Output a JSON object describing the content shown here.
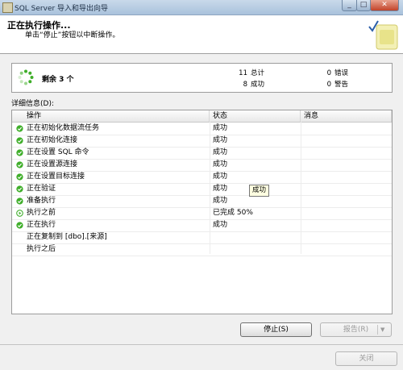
{
  "window": {
    "title": "SQL Server 导入和导出向导"
  },
  "header": {
    "title": "正在执行操作...",
    "subtitle": "单击“停止”按钮以中断操作。"
  },
  "summary": {
    "remaining": "剩余 3 个",
    "total_count": "11",
    "total_label": "总计",
    "success_count": "8",
    "success_label": "成功",
    "error_count": "0",
    "error_label": "错误",
    "warning_count": "0",
    "warning_label": "警告"
  },
  "details": {
    "label": "详细信息(D):",
    "columns": {
      "action": "操作",
      "status": "状态",
      "message": "消息"
    },
    "rows": [
      {
        "icon": "success-icon",
        "action": "正在初始化数据流任务",
        "status": "成功"
      },
      {
        "icon": "success-icon",
        "action": "正在初始化连接",
        "status": "成功"
      },
      {
        "icon": "success-icon",
        "action": "正在设置 SQL 命令",
        "status": "成功"
      },
      {
        "icon": "success-icon",
        "action": "正在设置源连接",
        "status": "成功"
      },
      {
        "icon": "success-icon",
        "action": "正在设置目标连接",
        "status": "成功"
      },
      {
        "icon": "success-icon",
        "action": "正在验证",
        "status": "成功"
      },
      {
        "icon": "success-icon",
        "action": "准备执行",
        "status": "成功"
      },
      {
        "icon": "in-progress-icon",
        "action": "执行之前",
        "status": "已完成 50%"
      },
      {
        "icon": "success-icon",
        "action": "正在执行",
        "status": "成功"
      },
      {
        "icon": "",
        "action": "正在复制到 [dbo].[来源]",
        "status": ""
      },
      {
        "icon": "",
        "action": "执行之后",
        "status": ""
      }
    ],
    "tooltip": "成功"
  },
  "buttons": {
    "stop": "停止(S)",
    "report": "报告(R)",
    "close": "关闭"
  },
  "colors": {
    "success": "#3fae2a",
    "titlebar": "#b9cde3"
  }
}
